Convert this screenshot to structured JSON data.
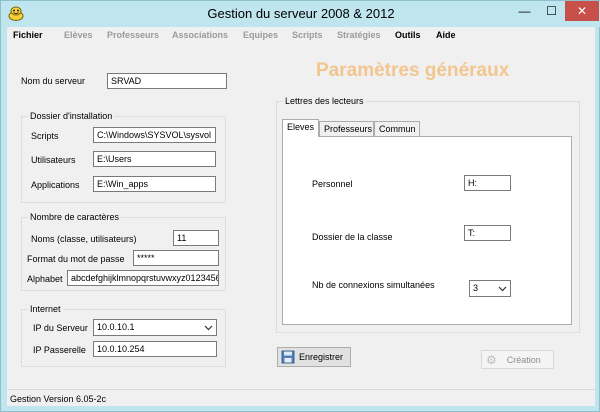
{
  "window": {
    "title": "Gestion du serveur  2008 & 2012",
    "minimize": "—",
    "maximize": "☐",
    "close": "✕"
  },
  "menu": [
    {
      "label": "Fichier",
      "enabled": true
    },
    {
      "label": "Elèves",
      "enabled": false
    },
    {
      "label": "Professeurs",
      "enabled": false
    },
    {
      "label": "Associations",
      "enabled": false
    },
    {
      "label": "Equipes",
      "enabled": false
    },
    {
      "label": "Scripts",
      "enabled": false
    },
    {
      "label": "Stratégies",
      "enabled": false
    },
    {
      "label": "Outils",
      "enabled": true
    },
    {
      "label": "Aide",
      "enabled": true
    }
  ],
  "server": {
    "label": "Nom du serveur",
    "value": "SRVAD"
  },
  "install": {
    "title": "Dossier d'installation",
    "scripts_label": "Scripts",
    "scripts_value": "C:\\Windows\\SYSVOL\\sysvol",
    "users_label": "Utilisateurs",
    "users_value": "E:\\Users",
    "apps_label": "Applications",
    "apps_value": "E:\\Win_apps"
  },
  "chars": {
    "title": "Nombre de caractères",
    "names_label": "Noms (classe, utilisateurs)",
    "names_value": "11",
    "pwd_label": "Format du mot de passe",
    "pwd_value": "*****",
    "alpha_label": "Alphabet",
    "alpha_value": "abcdefghijklmnopqrstuvwxyz0123456"
  },
  "internet": {
    "title": "Internet",
    "ip_label": "IP du Serveur",
    "ip_value": "10.0.10.1",
    "gw_label": "IP Passerelle",
    "gw_value": "10.0.10.254"
  },
  "params": {
    "title": "Paramètres généraux",
    "group_title": "Lettres des lecteurs",
    "tabs": [
      "Eleves",
      "Professeurs",
      "Commun"
    ],
    "active_tab": 0,
    "personnel_label": "Personnel",
    "personnel_value": "H:",
    "classe_label": "Dossier de la classe",
    "classe_value": "T:",
    "conn_label": "Nb de connexions simultanées",
    "conn_value": "3"
  },
  "buttons": {
    "save": "Enregistrer",
    "create": "Création"
  },
  "status": {
    "text": "Gestion Version 6.05-2c"
  },
  "colors": {
    "frame": "#bfe6ee",
    "title_accent": "#f3c68f",
    "close": "#c7504b"
  }
}
